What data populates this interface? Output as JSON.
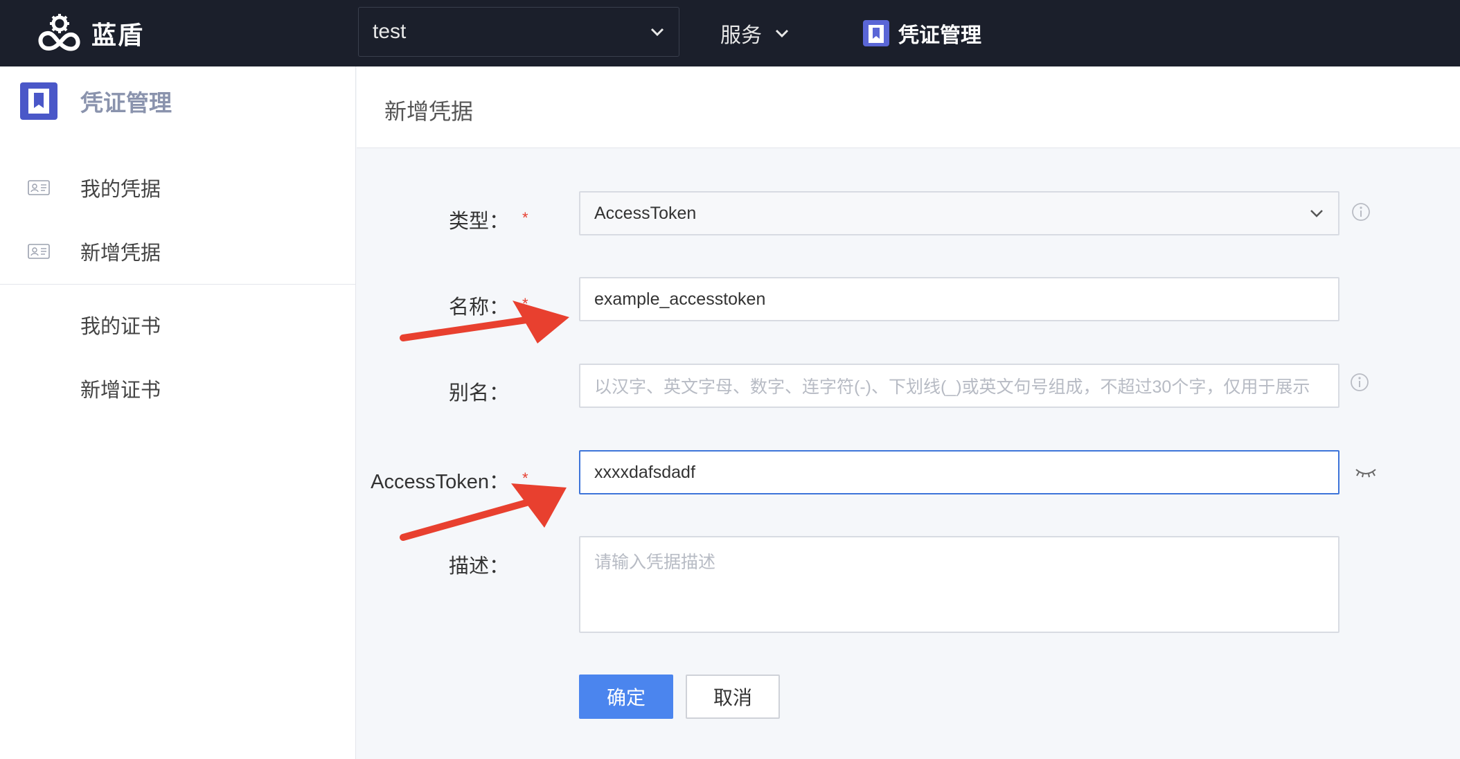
{
  "topbar": {
    "brand": "蓝盾",
    "project": "test",
    "services_label": "服务",
    "active_nav": "凭证管理"
  },
  "sidebar": {
    "title": "凭证管理",
    "items": [
      {
        "label": "我的凭据",
        "icon": "id-card-icon"
      },
      {
        "label": "新增凭据",
        "icon": "id-card-icon"
      },
      {
        "label": "我的证书"
      },
      {
        "label": "新增证书"
      }
    ]
  },
  "main": {
    "title": "新增凭据",
    "form": {
      "type": {
        "label": "类型：",
        "value": "AccessToken"
      },
      "name": {
        "label": "名称：",
        "value": "example_accesstoken"
      },
      "alias": {
        "label": "别名：",
        "placeholder": "以汉字、英文字母、数字、连字符(-)、下划线(_)或英文句号组成，不超过30个字，仅用于展示"
      },
      "token": {
        "label": "AccessToken：",
        "value": "xxxxdafsdadf"
      },
      "desc": {
        "label": "描述：",
        "placeholder": "请输入凭据描述"
      },
      "required_mark": "*"
    },
    "buttons": {
      "ok": "确定",
      "cancel": "取消"
    }
  },
  "colors": {
    "topbar": "#1b1f2b",
    "primary": "#4b85ee",
    "focus_border": "#3d74d9",
    "required": "#e63e2f",
    "annotation_arrow": "#e8402f"
  }
}
